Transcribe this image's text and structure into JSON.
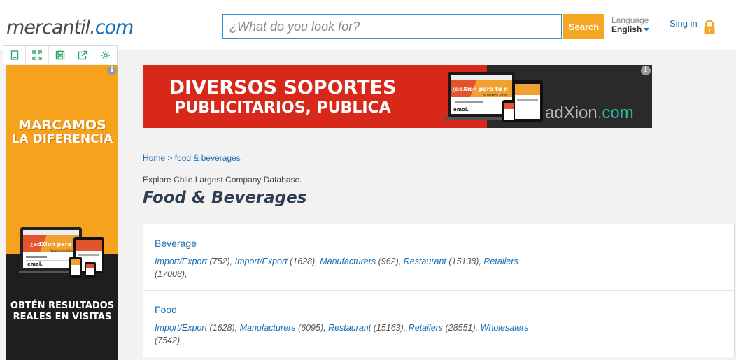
{
  "logo": {
    "part1": "mercantil",
    "part2": ".com"
  },
  "search": {
    "placeholder": "¿What do you look for?",
    "button": "Search"
  },
  "language": {
    "label": "Language",
    "value": "English"
  },
  "signin": "Sing in",
  "toolbar": {
    "icons": [
      "page-icon",
      "expand-icon",
      "save-icon",
      "share-icon",
      "settings-icon"
    ]
  },
  "left_ad": {
    "headline1": "MARCAMOS",
    "headline2": "LA DIFERENCIA",
    "device_text": "¿adXion para tu n",
    "device_sub": "Nuestros sitio",
    "brand": "emol.",
    "footer1": "OBTÉN RESULTADOS",
    "footer2": "REALES EN VISITAS",
    "colors": {
      "top": "#f7a21c",
      "bottom": "#1e1e1e"
    }
  },
  "banner": {
    "line1": "DIVERSOS SOPORTES",
    "line2": "PUBLICITARIOS, PUBLICA",
    "brand_a": "adXion",
    "brand_b": ".com",
    "device_text": "¿adXion para tu n",
    "device_sub": "Nuestros sitio",
    "emol": "emol.",
    "colors": {
      "left": "#d7281a",
      "right": "#2a2a2a"
    }
  },
  "breadcrumb": {
    "home": "Home",
    "sep": " > ",
    "current": "food & beverages"
  },
  "explore": "Explore Chile Largest Company Database.",
  "page_title": "Food & Beverages",
  "categories": [
    {
      "name": "Beverage",
      "items": [
        {
          "label": "Import/Export",
          "count": " (752), "
        },
        {
          "label": "Import/Export",
          "count": " (1628), "
        },
        {
          "label": "Manufacturers",
          "count": " (962), "
        },
        {
          "label": "Restaurant",
          "count": " (15138), "
        },
        {
          "label": "Retailers",
          "count": " (17008),"
        }
      ]
    },
    {
      "name": "Food",
      "items": [
        {
          "label": "Import/Export",
          "count": " (1628), "
        },
        {
          "label": "Manufacturers",
          "count": " (6095), "
        },
        {
          "label": "Restaurant",
          "count": " (15163), "
        },
        {
          "label": "Retailers",
          "count": " (28551), "
        },
        {
          "label": "Wholesalers",
          "count": " (7542),"
        }
      ]
    }
  ],
  "ad_info": "i"
}
